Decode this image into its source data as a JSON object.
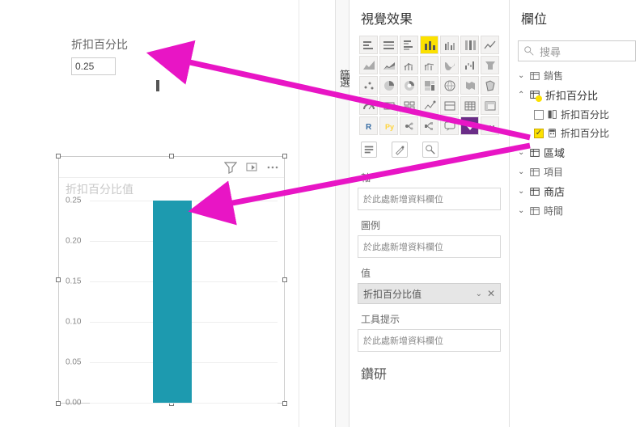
{
  "canvas": {
    "slicer": {
      "title": "折扣百分比",
      "value": "0.25"
    },
    "chart": {
      "title": "折扣百分比值"
    }
  },
  "chart_data": {
    "type": "bar",
    "categories": [
      ""
    ],
    "values": [
      0.25
    ],
    "title": "折扣百分比值",
    "ylabel": "",
    "xlabel": "",
    "ylim": [
      0,
      0.25
    ],
    "yticks": [
      0.0,
      0.05,
      0.1,
      0.15,
      0.2,
      0.25
    ]
  },
  "filters_tab": "篩選",
  "viz_panel": {
    "title": "視覺效果",
    "sections": {
      "axis": "軸",
      "legend": "圖例",
      "value": "值",
      "tooltip": "工具提示",
      "drill": "鑽研"
    },
    "placeholder": "於此處新增資料欄位",
    "value_pill": "折扣百分比值"
  },
  "fields_panel": {
    "title": "欄位",
    "search_placeholder": "搜尋",
    "tables": {
      "sales": "銷售",
      "discount": "折扣百分比",
      "region": "區域",
      "item": "項目",
      "store": "商店",
      "time": "時間"
    },
    "discount_fields": {
      "col": "折扣百分比",
      "measure": "折扣百分比"
    }
  },
  "ytick_labels": {
    "t0": "0.00",
    "t1": "0.05",
    "t2": "0.10",
    "t3": "0.15",
    "t4": "0.20",
    "t5": "0.25"
  }
}
